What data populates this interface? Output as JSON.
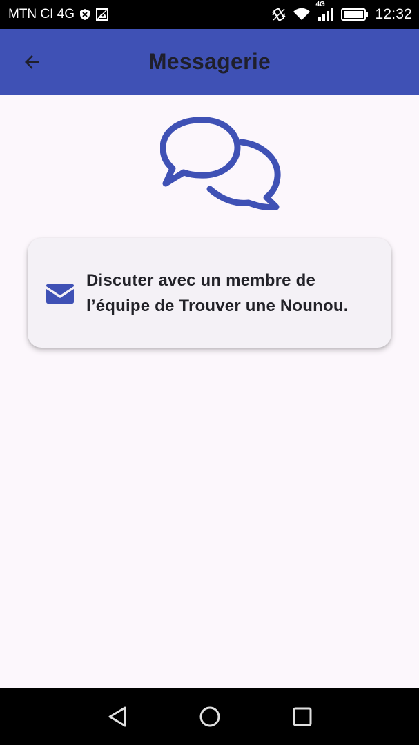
{
  "status_bar": {
    "carrier": "MTN CI 4G",
    "network_badge": "4G",
    "time": "12:32"
  },
  "app_bar": {
    "title": "Messagerie"
  },
  "card": {
    "text": "Discuter avec un membre de l’équipe de Trouver une Nounou."
  },
  "colors": {
    "primary": "#3f51b5",
    "background": "#fcf7fc",
    "card": "#f4f1f6"
  },
  "icons": [
    "back-arrow-icon",
    "chat-bubbles-icon",
    "mail-icon",
    "nav-back-icon",
    "nav-home-icon",
    "nav-recents-icon"
  ]
}
